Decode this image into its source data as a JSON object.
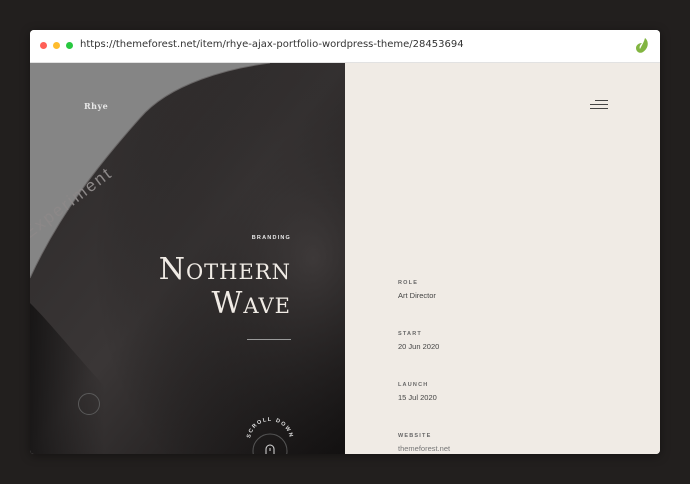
{
  "browser": {
    "url": "https://themeforest.net/item/rhye-ajax-portfolio-wordpress-theme/28453694",
    "extension_icon": "envato-leaf-icon",
    "extension_color": "#82b541"
  },
  "hero": {
    "logo": "Rhye",
    "category": "BRANDING",
    "title_line1": "Nothern",
    "title_line2": "Wave",
    "cover_text": "Experiment",
    "scroll_label": "SCROLL DOWN"
  },
  "details": {
    "menu_icon": "hamburger-menu-icon",
    "items": [
      {
        "label": "ROLE",
        "value": "Art Director"
      },
      {
        "label": "START",
        "value": "20 Jun 2020"
      },
      {
        "label": "LAUNCH",
        "value": "15 Jul 2020"
      },
      {
        "label": "WEBSITE",
        "value": "themeforest.net"
      }
    ]
  }
}
